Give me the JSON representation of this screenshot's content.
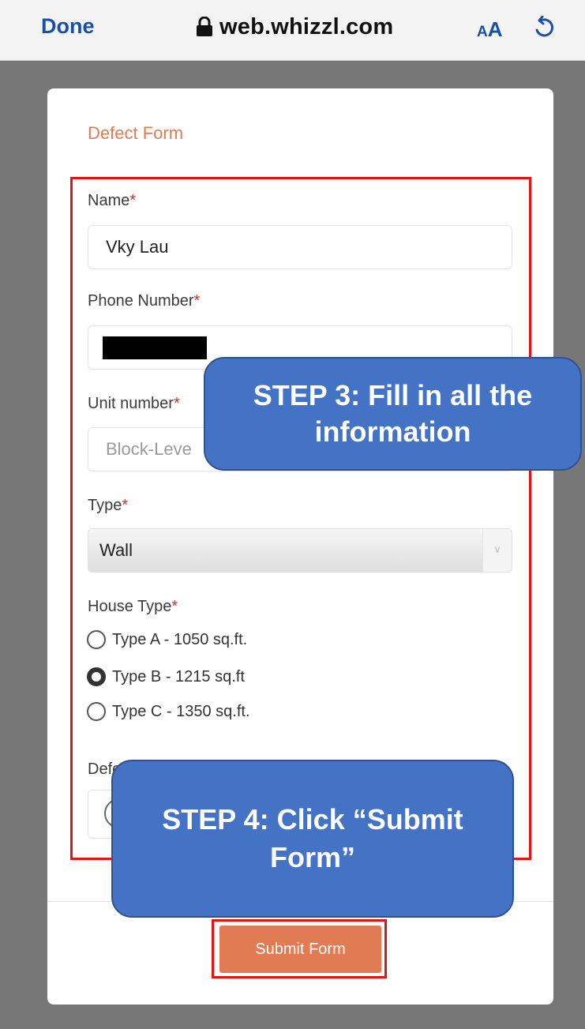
{
  "browser": {
    "done_label": "Done",
    "url": "web.whizzl.com",
    "text_size_small": "A",
    "text_size_large": "A"
  },
  "form": {
    "title": "Defect Form",
    "required_marker": "*",
    "name": {
      "label": "Name",
      "value": "Vky Lau"
    },
    "phone": {
      "label": "Phone Number",
      "value_redacted": true
    },
    "unit": {
      "label": "Unit number",
      "placeholder": "Block-Leve"
    },
    "type": {
      "label": "Type",
      "selected": "Wall"
    },
    "house_type": {
      "label": "House Type",
      "options": [
        {
          "label": "Type A - 1050 sq.ft.",
          "checked": false
        },
        {
          "label": "Type B - 1215 sq.ft",
          "checked": true
        },
        {
          "label": "Type C - 1350 sq.ft.",
          "checked": false
        }
      ]
    },
    "defect_image": {
      "label": "Defect Image"
    },
    "submit_label": "Submit Form"
  },
  "callouts": {
    "step3": "STEP 3: Fill in all the information",
    "step4": "STEP 4: Click “Submit Form”"
  },
  "colors": {
    "accent": "#e07b54",
    "link_blue": "#1a4fa8",
    "callout_blue": "#4472c4",
    "highlight_red": "#e01616"
  }
}
